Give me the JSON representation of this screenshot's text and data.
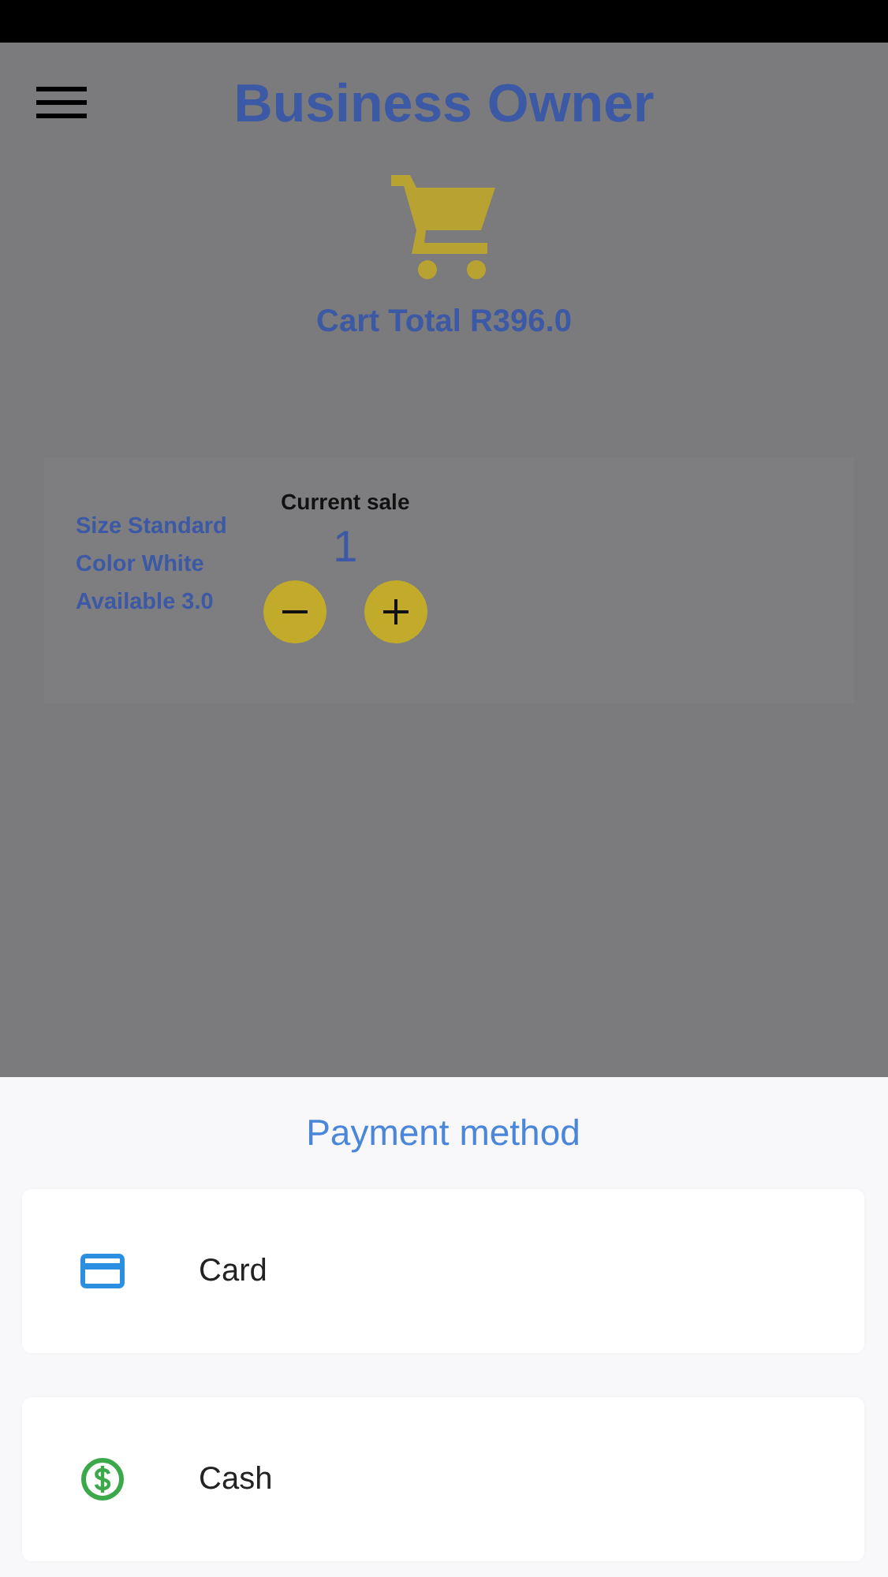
{
  "header": {
    "title": "Business Owner"
  },
  "cart": {
    "total": "Cart Total R396.0"
  },
  "product": {
    "details": [
      "Size Standard",
      "Color White",
      "Available 3.0"
    ],
    "sale_label": "Current sale",
    "quantity": "1"
  },
  "payment_sheet": {
    "title": "Payment method",
    "options": [
      {
        "kind": "card",
        "label": "Card"
      },
      {
        "kind": "cash",
        "label": "Cash"
      }
    ]
  }
}
